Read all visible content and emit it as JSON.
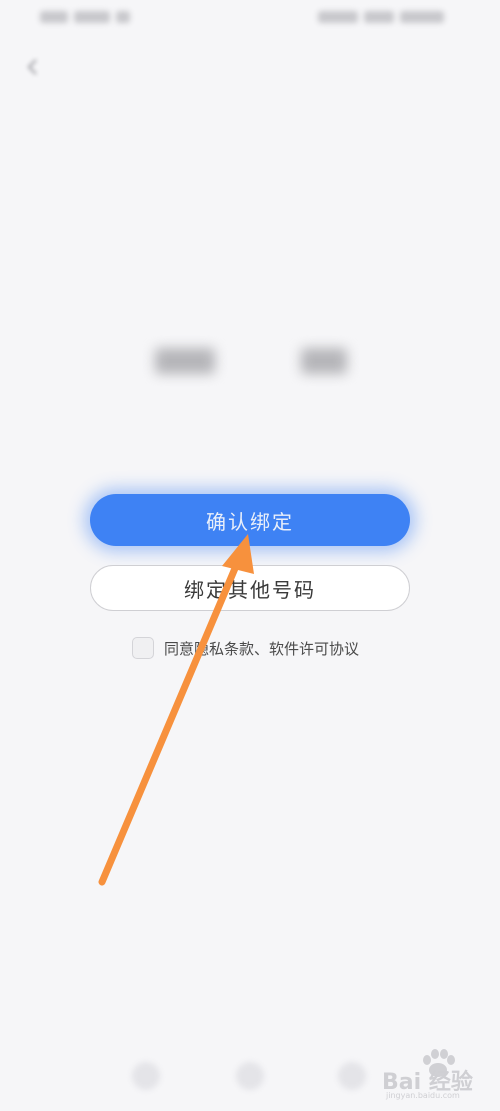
{
  "buttons": {
    "confirm_label": "确认绑定",
    "other_label": "绑定其他号码"
  },
  "agreement": {
    "text": "同意隐私条款、软件许可协议",
    "checked": false
  },
  "colors": {
    "primary": "#3e82f4",
    "arrow": "#f7913d",
    "background": "#f6f6f8"
  },
  "icons": {
    "back": "back-arrow-icon",
    "checkbox": "checkbox-icon"
  },
  "watermark": {
    "brand": "Bai",
    "brand_suffix": "经验",
    "url": "jingyan.baidu.com"
  }
}
